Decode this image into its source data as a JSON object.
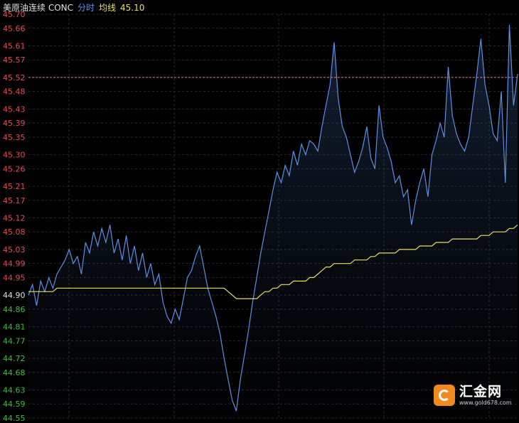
{
  "header": {
    "instrument": "美原油连续 CONC",
    "mode": "分时",
    "avg_label": "均线",
    "avg_value": "45.10"
  },
  "watermark": {
    "name": "汇金网",
    "url": "www.gold678.com"
  },
  "colors": {
    "background": "#000000",
    "grid": "#2a2a2a",
    "price_line": "#5b8fe6",
    "avg_line": "#e8e05a",
    "ref_line": "#e07878",
    "up_label": "#e84a4a",
    "down_label": "#3bbf3b",
    "ref_label": "#e0e0e0",
    "header_text": "#e0e0e0",
    "mode_text": "#5b8fe6",
    "avg_text": "#e8e05a"
  },
  "chart_data": {
    "type": "line",
    "ylim": [
      44.55,
      45.7
    ],
    "reference": 44.9,
    "reference_hline": 45.52,
    "y_ticks": [
      "45.70",
      "45.66",
      "45.61",
      "45.57",
      "45.52",
      "45.48",
      "45.43",
      "45.39",
      "45.35",
      "45.30",
      "45.26",
      "45.21",
      "45.17",
      "45.12",
      "45.08",
      "45.03",
      "44.99",
      "44.95",
      "44.90",
      "44.86",
      "44.81",
      "44.77",
      "44.72",
      "44.68",
      "44.63",
      "44.59",
      "44.55"
    ],
    "series": [
      {
        "values": [
          44.9,
          44.93,
          44.87,
          44.94,
          44.91,
          44.95,
          44.92,
          44.96,
          44.98,
          45.0,
          45.03,
          44.99,
          45.01,
          44.96,
          45.05,
          45.02,
          45.08,
          45.04,
          45.09,
          45.05,
          45.1,
          45.02,
          45.06,
          45.0,
          45.07,
          44.99,
          45.04,
          44.97,
          45.02,
          44.95,
          44.99,
          44.93,
          44.96,
          44.88,
          44.84,
          44.82,
          44.86,
          44.83,
          44.89,
          44.95,
          44.97,
          45.01,
          45.04,
          44.98,
          44.92,
          44.88,
          44.84,
          44.79,
          44.72,
          44.66,
          44.6,
          44.57,
          44.66,
          44.73,
          44.8,
          44.88,
          44.95,
          45.02,
          45.08,
          45.14,
          45.2,
          45.25,
          45.22,
          45.27,
          45.24,
          45.31,
          45.27,
          45.33,
          45.3,
          45.34,
          45.33,
          45.31,
          45.38,
          45.44,
          45.5,
          45.62,
          45.46,
          45.38,
          45.35,
          45.3,
          45.25,
          45.28,
          45.32,
          45.38,
          45.29,
          45.26,
          45.44,
          45.35,
          45.32,
          45.28,
          45.22,
          45.24,
          45.18,
          45.2,
          45.1,
          45.17,
          45.22,
          45.26,
          45.18,
          45.3,
          45.34,
          45.39,
          45.35,
          45.55,
          45.41,
          45.36,
          45.33,
          45.31,
          45.35,
          45.44,
          45.53,
          45.63,
          45.5,
          45.44,
          45.36,
          45.34,
          45.48,
          45.22,
          45.67,
          45.44,
          45.53
        ]
      },
      {
        "values": [
          44.91,
          44.91,
          44.91,
          44.91,
          44.91,
          44.91,
          44.91,
          44.92,
          44.92,
          44.92,
          44.92,
          44.92,
          44.92,
          44.92,
          44.92,
          44.92,
          44.92,
          44.92,
          44.92,
          44.92,
          44.92,
          44.92,
          44.92,
          44.92,
          44.92,
          44.92,
          44.92,
          44.92,
          44.92,
          44.92,
          44.92,
          44.92,
          44.92,
          44.92,
          44.92,
          44.92,
          44.92,
          44.92,
          44.92,
          44.92,
          44.92,
          44.92,
          44.92,
          44.92,
          44.92,
          44.92,
          44.92,
          44.92,
          44.92,
          44.91,
          44.9,
          44.89,
          44.89,
          44.89,
          44.89,
          44.89,
          44.89,
          44.9,
          44.91,
          44.91,
          44.92,
          44.92,
          44.93,
          44.93,
          44.93,
          44.94,
          44.94,
          44.94,
          44.94,
          44.95,
          44.95,
          44.96,
          44.97,
          44.98,
          44.98,
          44.99,
          44.99,
          44.99,
          44.99,
          44.99,
          45.0,
          45.0,
          45.0,
          45.0,
          45.01,
          45.01,
          45.02,
          45.02,
          45.02,
          45.02,
          45.02,
          45.03,
          45.03,
          45.03,
          45.03,
          45.03,
          45.04,
          45.04,
          45.04,
          45.04,
          45.05,
          45.05,
          45.05,
          45.05,
          45.06,
          45.06,
          45.06,
          45.06,
          45.06,
          45.06,
          45.06,
          45.07,
          45.07,
          45.07,
          45.08,
          45.08,
          45.08,
          45.08,
          45.09,
          45.09,
          45.1
        ]
      }
    ]
  }
}
